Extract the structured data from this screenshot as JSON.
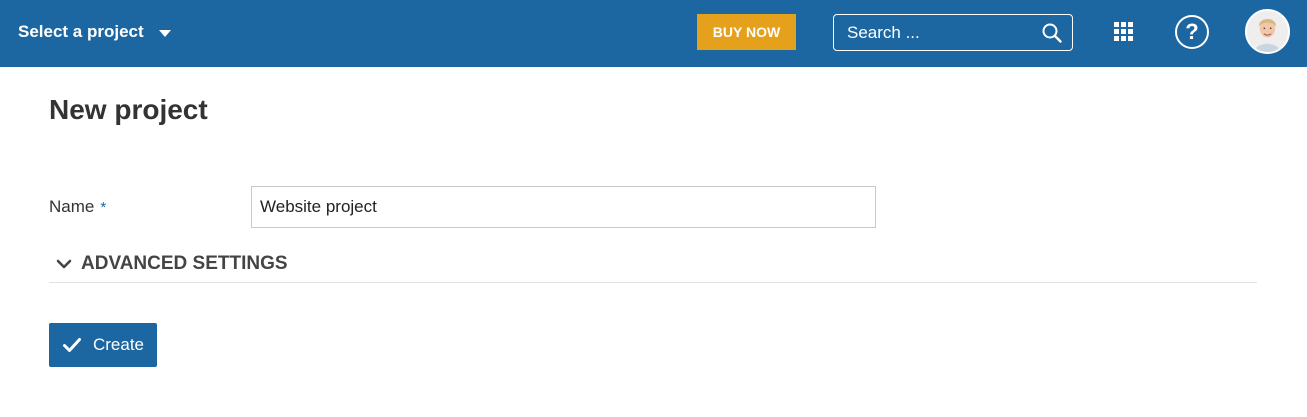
{
  "header": {
    "project_select_label": "Select a project",
    "buy_now_label": "BUY NOW",
    "search_placeholder": "Search ...",
    "help_label": "?",
    "icons": [
      "caret-down-icon",
      "search-icon",
      "apps-grid-icon",
      "help-icon",
      "avatar"
    ],
    "colors": {
      "header_bg": "#1c67a2",
      "buy_now_bg": "#e5a11b"
    }
  },
  "main": {
    "title": "New project",
    "name_label": "Name",
    "required_marker": "*",
    "name_value": "Website project",
    "advanced_settings_label": "ADVANCED SETTINGS",
    "create_label": "Create",
    "colors": {
      "primary": "#1c67a2"
    }
  }
}
